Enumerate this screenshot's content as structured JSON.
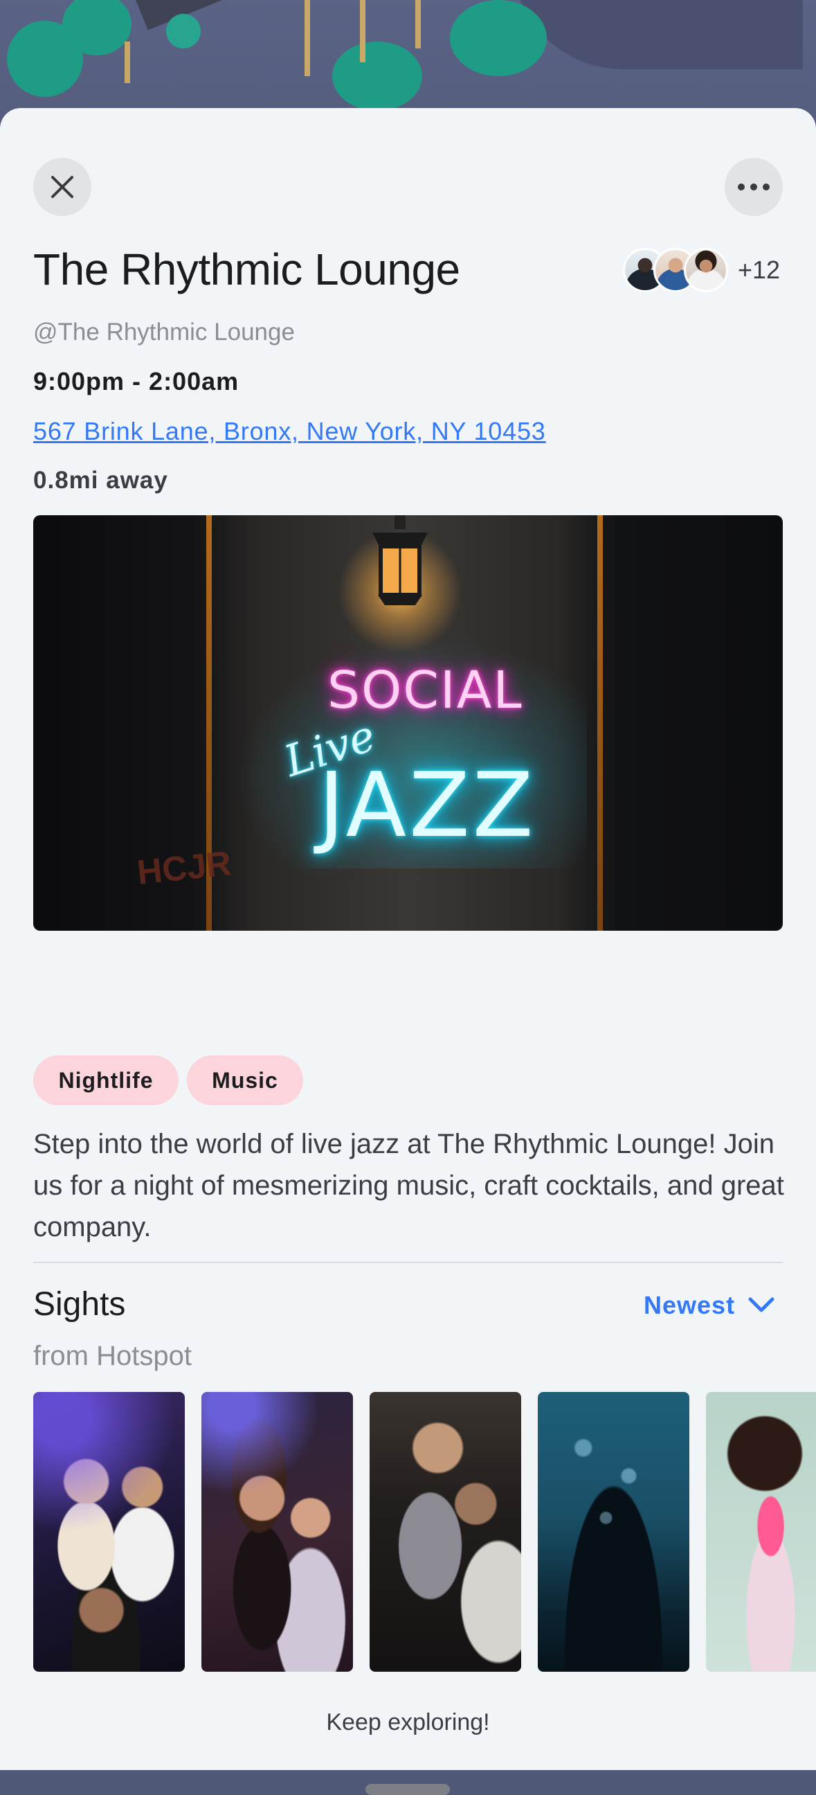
{
  "venue": {
    "name": "The Rhythmic Lounge",
    "handle": "@The Rhythmic Lounge",
    "hours": "9:00pm - 2:00am",
    "address": "567 Brink Lane, Bronx, New York, NY 10453",
    "distance": "0.8mi away",
    "attendees_extra": "+12"
  },
  "hero_image": {
    "sign_line1": "SOCIAL",
    "sign_line2": "Live",
    "sign_line3": "JAZZ"
  },
  "tags": [
    "Nightlife",
    "Music"
  ],
  "description": "Step into the world of live jazz at The Rhythmic Lounge! Join us for a night of mesmerizing music, craft cocktails, and great company.",
  "sights": {
    "title": "Sights",
    "subtitle": "from Hotspot",
    "sort_label": "Newest"
  },
  "footer": {
    "text": "Keep exploring!"
  },
  "colors": {
    "accent": "#3478f6",
    "tag_bg": "#fbd4dc",
    "sheet_bg": "#f2f5f7"
  },
  "icons": {
    "close": "close-icon",
    "more": "more-horizontal-icon",
    "sort": "chevron-down-icon"
  }
}
